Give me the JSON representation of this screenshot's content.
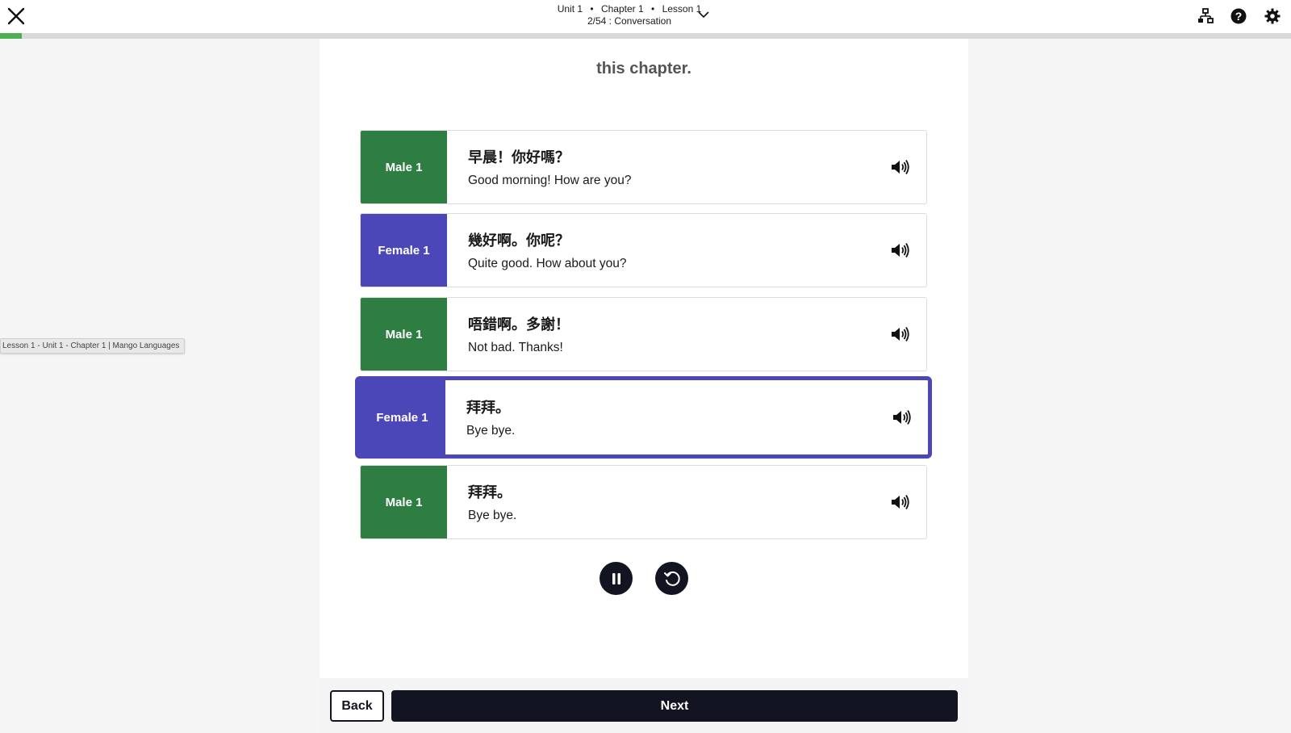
{
  "header": {
    "breadcrumb": {
      "unit": "Unit 1",
      "chapter": "Chapter 1",
      "lesson": "Lesson 1",
      "separator": "•",
      "step": "2/54 : Conversation"
    },
    "icons": {
      "close": "close-icon",
      "toggle": "chevron-down-icon",
      "outline": "hierarchy-icon",
      "help": "help-icon",
      "settings": "gear-icon"
    }
  },
  "progress": {
    "fraction": 0.017,
    "color": "#4caf50"
  },
  "content": {
    "chapter_text": "this chapter.",
    "lines": [
      {
        "speaker": "Male 1",
        "gender": "male",
        "native": "早晨！你好嗎？",
        "translation": "Good morning! How are you?",
        "active": false
      },
      {
        "speaker": "Female 1",
        "gender": "female",
        "native": "幾好啊。你呢？",
        "translation": "Quite good. How about you?",
        "active": false
      },
      {
        "speaker": "Male 1",
        "gender": "male",
        "native": "唔錯啊。多謝！",
        "translation": "Not bad. Thanks!",
        "active": false
      },
      {
        "speaker": "Female 1",
        "gender": "female",
        "native": "拜拜。",
        "translation": "Bye bye.",
        "active": true
      },
      {
        "speaker": "Male 1",
        "gender": "male",
        "native": "拜拜。",
        "translation": "Bye bye.",
        "active": false
      }
    ],
    "controls": {
      "pause": "pause-icon",
      "replay": "replay-icon"
    }
  },
  "footer": {
    "back_label": "Back",
    "next_label": "Next"
  },
  "tooltip": {
    "text": "Lesson 1 - Unit 1 - Chapter 1 | Mango Languages"
  },
  "colors": {
    "male": "#2e7d43",
    "female": "#4b47b8",
    "dark": "#121421"
  }
}
